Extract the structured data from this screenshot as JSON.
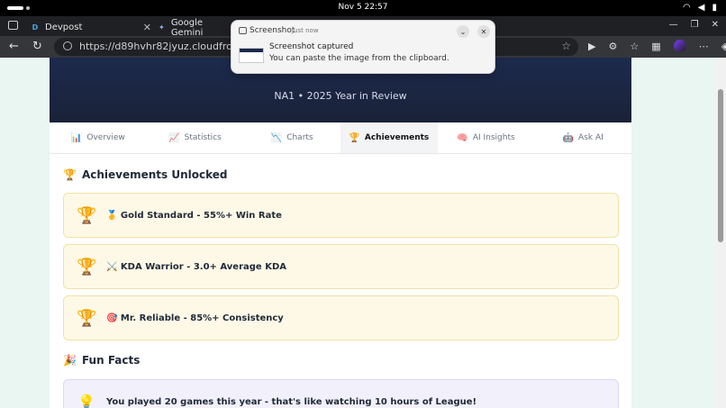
{
  "system_bar": {
    "clock": "Nov 5  22:57"
  },
  "browser": {
    "tabs": [
      {
        "title": "Devpost",
        "favicon": "devpost-icon"
      },
      {
        "title": "Google Gemini",
        "favicon": "gemini-icon"
      }
    ],
    "url": "https://d89hvhr82jyuz.cloudfront.net"
  },
  "notification": {
    "app": "Screenshot",
    "time": "Just now",
    "title": "Screenshot captured",
    "body": "You can paste the image from the clipboard."
  },
  "hero": {
    "subtitle": "NA1 • 2025 Year in Review"
  },
  "tabs": [
    {
      "icon": "📊",
      "label": "Overview"
    },
    {
      "icon": "📈",
      "label": "Statistics"
    },
    {
      "icon": "📉",
      "label": "Charts"
    },
    {
      "icon": "🏆",
      "label": "Achievements",
      "active": true
    },
    {
      "icon": "🧠",
      "label": "AI Insights"
    },
    {
      "icon": "🤖",
      "label": "Ask AI"
    }
  ],
  "achievements": {
    "title": "Achievements Unlocked",
    "items": [
      {
        "label": "🥇 Gold Standard - 55%+ Win Rate"
      },
      {
        "label": "⚔️ KDA Warrior - 3.0+ Average KDA"
      },
      {
        "label": "🎯 Mr. Reliable - 85%+ Consistency"
      }
    ]
  },
  "fun_facts": {
    "title": "Fun Facts",
    "items": [
      {
        "label": "You played 20 games this year - that's like watching 10 hours of League!"
      }
    ]
  },
  "colors": {
    "hero_bg": "#1c2a4c",
    "achievement_bg": "#fef9e7",
    "fact_bg": "#f1f0fb",
    "page_bg": "#e9f6f1"
  }
}
